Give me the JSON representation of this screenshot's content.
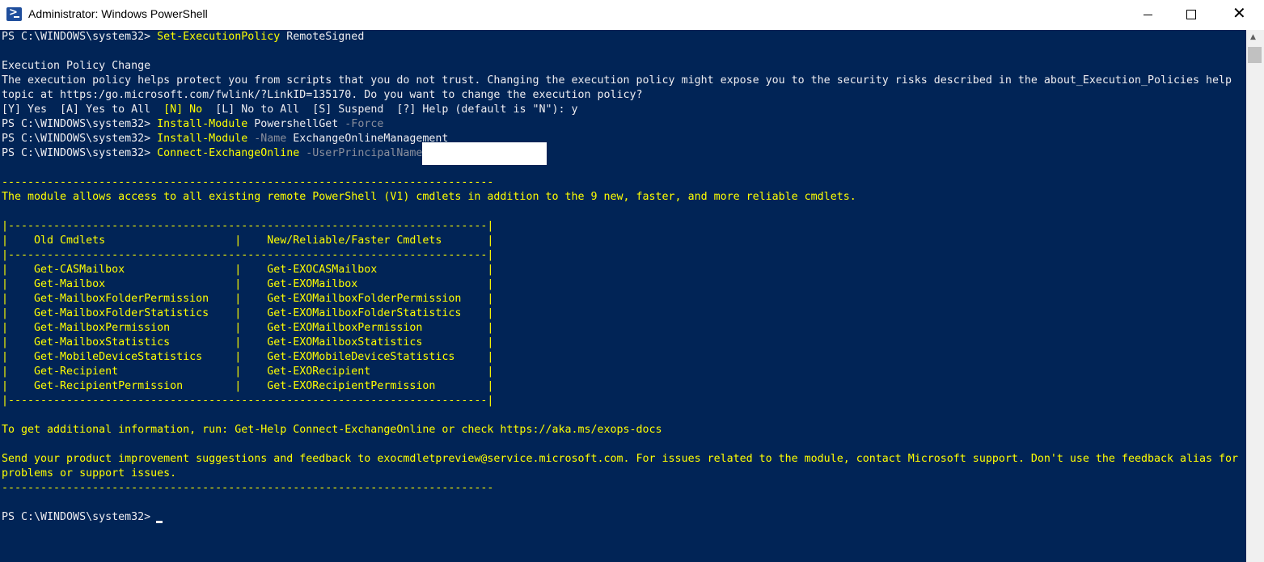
{
  "window": {
    "title": "Administrator: Windows PowerShell",
    "icon": "powershell-icon",
    "controls": {
      "minimize": "minimize-icon",
      "maximize": "maximize-icon",
      "close": "✕"
    }
  },
  "colors": {
    "background": "#012456",
    "text": "#eeedf0",
    "highlight": "#ffff00",
    "param": "#8a8f9c"
  },
  "console": {
    "prompt": "PS C:\\WINDOWS\\system32> ",
    "cmd1": {
      "cmdlet": "Set-ExecutionPolicy",
      "arg": " RemoteSigned"
    },
    "policy_title": "Execution Policy Change",
    "policy_body1": "The execution policy helps protect you from scripts that you do not trust. Changing the execution policy might expose you to the security risks described in the about_Execution_Policies help",
    "policy_body2": "topic at https:/go.microsoft.com/fwlink/?LinkID=135170. Do you want to change the execution policy?",
    "choice_a": "[Y] Yes  [A] Yes to All  ",
    "choice_n": "[N] No",
    "choice_b": "  [L] No to All  [S] Suspend  [?] Help (default is \"N\"): y",
    "cmd2": {
      "cmdlet": "Install-Module",
      "arg": " PowershellGet",
      "param": " -Force"
    },
    "cmd3": {
      "cmdlet": "Install-Module",
      "param": " -Name",
      "arg": " ExchangeOnlineManagement"
    },
    "cmd4": {
      "cmdlet": "Connect-ExchangeOnline",
      "param": " -UserPrincipalName"
    },
    "divider": "----------------------------------------------------------------------------",
    "module_note": "The module allows access to all existing remote PowerShell (V1) cmdlets in addition to the 9 new, faster, and more reliable cmdlets.",
    "table_border": "|--------------------------------------------------------------------------|",
    "table_header": "|    Old Cmdlets                    |    New/Reliable/Faster Cmdlets       |",
    "table_rows": [
      "|    Get-CASMailbox                 |    Get-EXOCASMailbox                 |",
      "|    Get-Mailbox                    |    Get-EXOMailbox                    |",
      "|    Get-MailboxFolderPermission    |    Get-EXOMailboxFolderPermission    |",
      "|    Get-MailboxFolderStatistics    |    Get-EXOMailboxFolderStatistics    |",
      "|    Get-MailboxPermission          |    Get-EXOMailboxPermission          |",
      "|    Get-MailboxStatistics          |    Get-EXOMailboxStatistics          |",
      "|    Get-MobileDeviceStatistics     |    Get-EXOMobileDeviceStatistics     |",
      "|    Get-Recipient                  |    Get-EXORecipient                  |",
      "|    Get-RecipientPermission        |    Get-EXORecipientPermission        |"
    ],
    "help_line": "To get additional information, run: Get-Help Connect-ExchangeOnline or check https://aka.ms/exops-docs",
    "feedback1": "Send your product improvement suggestions and feedback to exocmdletpreview@service.microsoft.com. For issues related to the module, contact Microsoft support. Don't use the feedback alias for",
    "feedback2": "problems or support issues."
  }
}
